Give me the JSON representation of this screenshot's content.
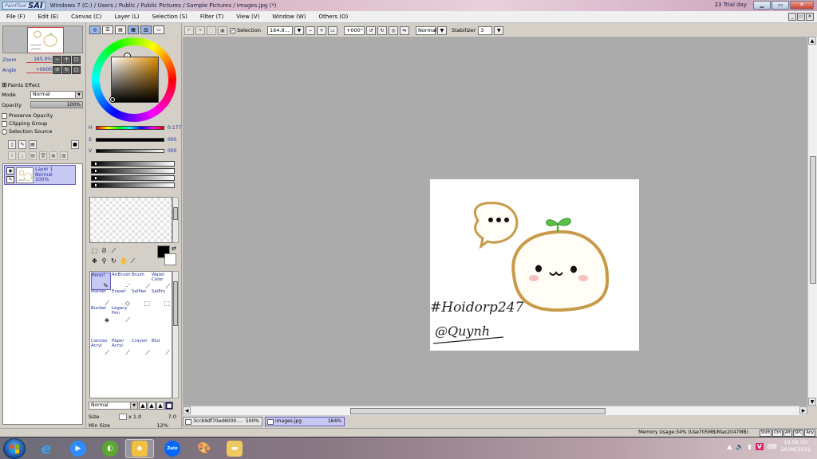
{
  "titlebar": {
    "logo_small": "PaintTool",
    "logo_big": "SAI",
    "title": "Windows 7 (C:) / Users / Public / Public Pictures / Sample Pictures / images.jpg (*)",
    "trial": "23 Trial day"
  },
  "menu": [
    "File (F)",
    "Edit (E)",
    "Canvas (C)",
    "Layer (L)",
    "Selection (S)",
    "Filter (T)",
    "View (V)",
    "Window (W)",
    "Others (O)"
  ],
  "navigator": {
    "zoom_label": "Zoom",
    "zoom_value": "165.0%",
    "angle_label": "Angle",
    "angle_value": "+0000"
  },
  "layer_props": {
    "paints_effect": "Paints Effect",
    "mode_label": "Mode",
    "mode_value": "Normal",
    "opacity_label": "Opacity",
    "opacity_value": "100%",
    "preserve_opacity": "Preserve Opacity",
    "clipping_group": "Clipping Group",
    "selection_source": "Selection Source"
  },
  "layers": [
    {
      "name": "Layer 1",
      "mode": "Normal",
      "opacity": "100%"
    }
  ],
  "color": {
    "h_label": "H",
    "h_value": "0:177",
    "s_label": "S",
    "s_value": "000",
    "v_label": "V",
    "v_value": "000",
    "wheel_hue": "#e08c00"
  },
  "brushes": [
    {
      "name": "Pencil",
      "selected": true
    },
    {
      "name": "AirBrush"
    },
    {
      "name": "Brush"
    },
    {
      "name": "Water Color"
    },
    {
      "name": "Marker"
    },
    {
      "name": "Eraser"
    },
    {
      "name": "SelPen"
    },
    {
      "name": "SelErs"
    },
    {
      "name": "Bucket"
    },
    {
      "name": "Legacy Pen"
    },
    {
      "name": "Canvas Acryl"
    },
    {
      "name": "Paper Acryl"
    },
    {
      "name": "Crayon"
    },
    {
      "name": "Blur"
    }
  ],
  "brush_settings": {
    "blend_mode": "Normal",
    "size_label": "Size",
    "size_mult": "x 1.0",
    "size_value": "7.0",
    "min_size_label": "Min Size",
    "min_size_value": "12%"
  },
  "toolbar": {
    "selection_label": "Selection",
    "zoom_value": "164.9...",
    "angle_value": "+000°",
    "blend_mode": "Normal",
    "stabilizer_label": "Stabilizer",
    "stabilizer_value": "3"
  },
  "artwork": {
    "hashtag": "#Hoidorp247",
    "signature": "@Quynh"
  },
  "doc_tabs": [
    {
      "name": "3ccb9df70ed6000....",
      "zoom": "500%"
    },
    {
      "name": "images.jpg",
      "zoom": "164%",
      "active": true
    }
  ],
  "status": {
    "memory": "Memory Usage:34% (Use705MB/Max2047MB)",
    "keys": [
      "Shift",
      "Ctrl",
      "Alt",
      "SPC",
      "Any"
    ]
  },
  "taskbar": {
    "apps": [
      "ie-icon",
      "zoom-icon",
      "coccoc-icon",
      "paintsai-icon",
      "zalo-icon",
      "paint-icon",
      "explorer-icon"
    ],
    "zalo_label": "Zalo",
    "time": "10:56 CH",
    "date": "26/06/2021"
  }
}
